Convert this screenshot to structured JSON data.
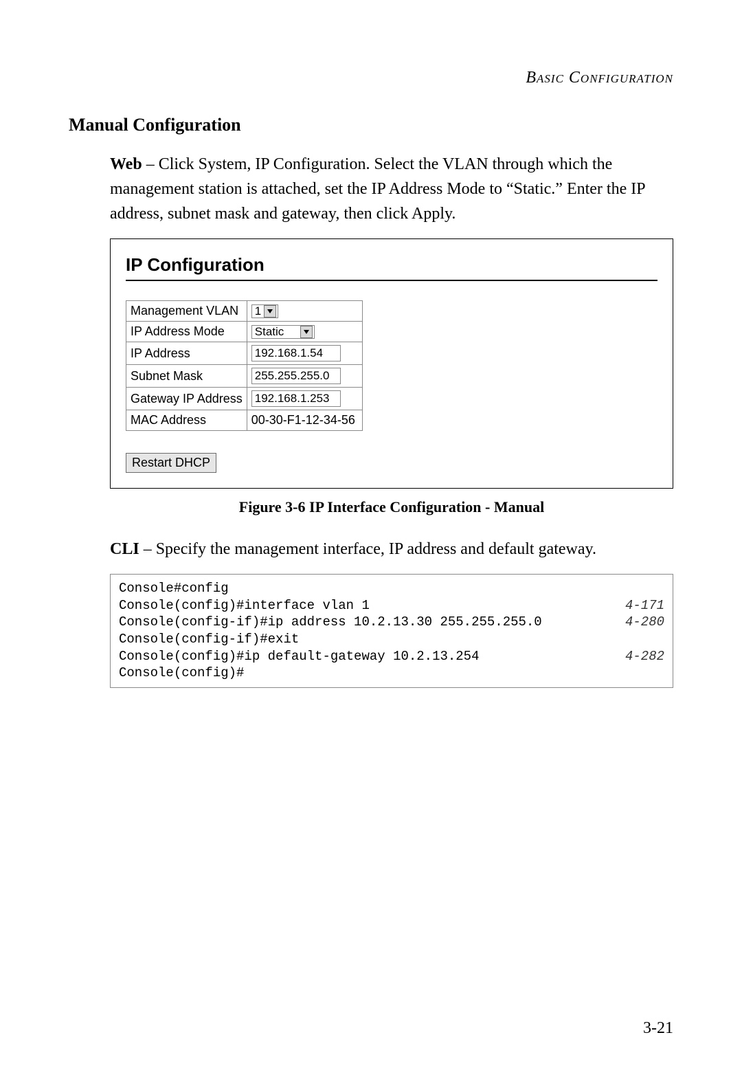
{
  "header": {
    "running_head": "Basic Configuration"
  },
  "section": {
    "title": "Manual Configuration"
  },
  "web_paragraph": {
    "lead": "Web",
    "text": " – Click System, IP Configuration. Select the VLAN through which the management station is attached, set the IP Address Mode to “Static.” Enter the IP address, subnet mask and gateway, then click Apply."
  },
  "panel": {
    "title": "IP Configuration",
    "rows": {
      "mgmt_vlan_label": "Management VLAN",
      "mgmt_vlan_value": "1",
      "ip_mode_label": "IP Address Mode",
      "ip_mode_value": "Static",
      "ip_addr_label": "IP Address",
      "ip_addr_value": "192.168.1.54",
      "subnet_label": "Subnet Mask",
      "subnet_value": "255.255.255.0",
      "gateway_label": "Gateway IP Address",
      "gateway_value": "192.168.1.253",
      "mac_label": "MAC Address",
      "mac_value": "00-30-F1-12-34-56"
    },
    "restart_button": "Restart DHCP"
  },
  "figure_caption": "Figure 3-6  IP Interface Configuration - Manual",
  "cli_paragraph": {
    "lead": "CLI",
    "text": " – Specify the management interface, IP address and default gateway."
  },
  "cli": {
    "lines": [
      {
        "cmd": "Console#config",
        "ref": ""
      },
      {
        "cmd": "Console(config)#interface vlan 1",
        "ref": "4-171"
      },
      {
        "cmd": "Console(config-if)#ip address 10.2.13.30 255.255.255.0",
        "ref": "4-280"
      },
      {
        "cmd": "Console(config-if)#exit",
        "ref": ""
      },
      {
        "cmd": "Console(config)#ip default-gateway 10.2.13.254",
        "ref": "4-282"
      },
      {
        "cmd": "Console(config)#",
        "ref": ""
      }
    ]
  },
  "page_number": "3-21"
}
